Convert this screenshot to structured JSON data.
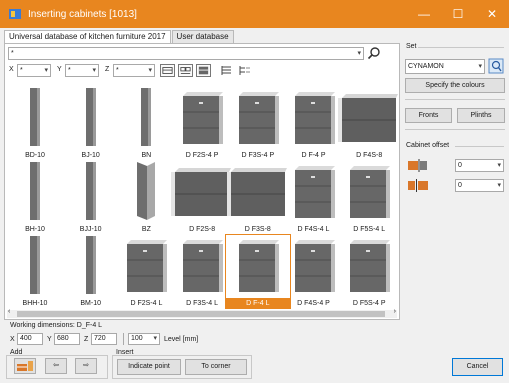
{
  "window": {
    "title": "Inserting cabinets [1013]",
    "minimize": "—",
    "maximize": "☐",
    "close": "✕"
  },
  "tabs": [
    {
      "label": "Universal database of kitchen furniture 2017"
    },
    {
      "label": "User database"
    }
  ],
  "filter": {
    "path_value": "*",
    "x_label": "X",
    "x_value": "*",
    "y_label": "Y",
    "y_value": "*",
    "z_label": "Z",
    "z_value": "*"
  },
  "cabinets": [
    {
      "label": "BD-10",
      "kind": "tall"
    },
    {
      "label": "BJ-10",
      "kind": "tall"
    },
    {
      "label": "BN",
      "kind": "tall"
    },
    {
      "label": "D F2S-4 P",
      "kind": "box"
    },
    {
      "label": "D F3S-4 P",
      "kind": "box"
    },
    {
      "label": "D F-4 P",
      "kind": "box"
    },
    {
      "label": "D F4S-8",
      "kind": "wide"
    },
    {
      "label": "BH-10",
      "kind": "tall"
    },
    {
      "label": "BJJ-10",
      "kind": "tall"
    },
    {
      "label": "BZ",
      "kind": "corner"
    },
    {
      "label": "D F2S-8",
      "kind": "wide"
    },
    {
      "label": "D F3S-8",
      "kind": "wide"
    },
    {
      "label": "D F4S-4 L",
      "kind": "box"
    },
    {
      "label": "D F5S-4 L",
      "kind": "box"
    },
    {
      "label": "BHH-10",
      "kind": "tall"
    },
    {
      "label": "BM-10",
      "kind": "tall"
    },
    {
      "label": "D F2S-4 L",
      "kind": "box"
    },
    {
      "label": "D F3S-4 L",
      "kind": "box"
    },
    {
      "label": "D F-4 L",
      "kind": "box",
      "selected": true
    },
    {
      "label": "D F4S-4 P",
      "kind": "box"
    },
    {
      "label": "D F5S-4 P",
      "kind": "box"
    }
  ],
  "right": {
    "set_label": "Set",
    "set_value": "CYNAMON",
    "specify_colours": "Specify the colours",
    "fronts": "Fronts",
    "plinths": "Plinths",
    "offset_label": "Cabinet offset",
    "offset1": "0",
    "offset2": "0"
  },
  "dims": {
    "label": "Working dimensions: D_F-4 L",
    "x_label": "X",
    "x_value": "400",
    "y_label": "Y",
    "y_value": "680",
    "z_label": "Z",
    "z_value": "720",
    "level_value": "100",
    "level_label": "Level [mm]"
  },
  "add": {
    "label": "Add"
  },
  "insert": {
    "label": "Insert",
    "indicate_point": "Indicate point",
    "to_corner": "To corner"
  },
  "cancel": "Cancel"
}
